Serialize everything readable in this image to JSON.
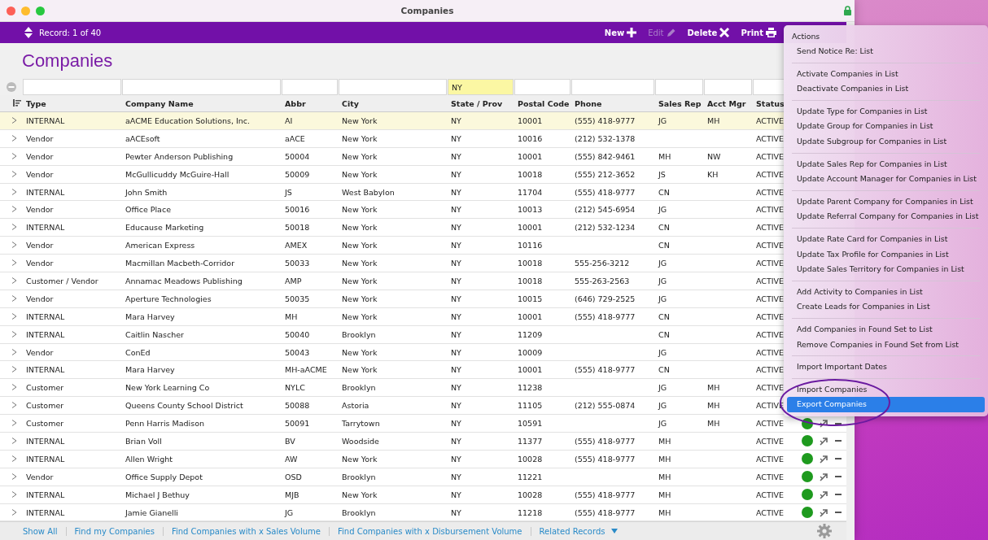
{
  "window": {
    "title": "Companies"
  },
  "toolbar": {
    "record": "Record: 1 of 40",
    "buttons": [
      {
        "label": "New",
        "kind": "new",
        "disabled": false
      },
      {
        "label": "Edit",
        "kind": "edit",
        "disabled": true
      },
      {
        "label": "Delete",
        "kind": "delete",
        "disabled": false
      },
      {
        "label": "Print",
        "kind": "print",
        "disabled": false
      }
    ]
  },
  "heading": "Companies",
  "filters": {
    "state": "NY"
  },
  "table": {
    "columns": [
      {
        "label": "Type"
      },
      {
        "label": "Company Name"
      },
      {
        "label": "Abbr"
      },
      {
        "label": "City"
      },
      {
        "label": "State / Prov"
      },
      {
        "label": "Postal Code"
      },
      {
        "label": "Phone"
      },
      {
        "label": "Sales Rep"
      },
      {
        "label": "Acct Mgr"
      },
      {
        "label": "Status"
      }
    ],
    "rows": [
      {
        "selected": true,
        "markers": false,
        "type": "INTERNAL",
        "company": "aACME Education Solutions, Inc.",
        "abbr": "AI",
        "city": "New York",
        "state": "NY",
        "postal": "10001",
        "phone": "(555) 418-9777",
        "sales_rep": "JG",
        "acct_mgr": "MH",
        "status": "ACTIVE"
      },
      {
        "selected": false,
        "markers": false,
        "type": "Vendor",
        "company": "aACEsoft",
        "abbr": "aACE",
        "city": "New York",
        "state": "NY",
        "postal": "10016",
        "phone": "(212) 532-1378",
        "status": "ACTIVE"
      },
      {
        "selected": false,
        "markers": false,
        "type": "Vendor",
        "company": "Pewter Anderson Publishing",
        "abbr": "50004",
        "city": "New York",
        "state": "NY",
        "postal": "10001",
        "phone": "(555) 842-9461",
        "sales_rep": "MH",
        "acct_mgr": "NW",
        "status": "ACTIVE"
      },
      {
        "selected": false,
        "markers": false,
        "type": "Vendor",
        "company": "McGullicuddy McGuire-Hall",
        "abbr": "50009",
        "city": "New York",
        "state": "NY",
        "postal": "10018",
        "phone": "(555) 212-3652",
        "sales_rep": "JS",
        "acct_mgr": "KH",
        "status": "ACTIVE"
      },
      {
        "selected": false,
        "markers": false,
        "type": "INTERNAL",
        "company": "John Smith",
        "abbr": "JS",
        "city": "West Babylon",
        "state": "NY",
        "postal": "11704",
        "phone": "(555) 418-9777",
        "sales_rep": "CN",
        "status": "ACTIVE"
      },
      {
        "selected": false,
        "markers": false,
        "type": "Vendor",
        "company": "Office Place",
        "abbr": "50016",
        "city": "New York",
        "state": "NY",
        "postal": "10013",
        "phone": "(212) 545-6954",
        "sales_rep": "JG",
        "status": "ACTIVE"
      },
      {
        "selected": false,
        "markers": false,
        "type": "INTERNAL",
        "company": "Educause Marketing",
        "abbr": "50018",
        "city": "New York",
        "state": "NY",
        "postal": "10001",
        "phone": "(212) 532-1234",
        "sales_rep": "CN",
        "status": "ACTIVE"
      },
      {
        "selected": false,
        "markers": false,
        "type": "Vendor",
        "company": "American Express",
        "abbr": "AMEX",
        "city": "New York",
        "state": "NY",
        "postal": "10116",
        "sales_rep": "CN",
        "status": "ACTIVE"
      },
      {
        "selected": false,
        "markers": false,
        "type": "Vendor",
        "company": "Macmillan Macbeth-Corridor",
        "abbr": "50033",
        "city": "New York",
        "state": "NY",
        "postal": "10018",
        "phone": "555-256-3212",
        "sales_rep": "JG",
        "status": "ACTIVE"
      },
      {
        "selected": false,
        "markers": false,
        "type": "Customer / Vendor",
        "company": "Annamac Meadows Publishing",
        "abbr": "AMP",
        "city": "New York",
        "state": "NY",
        "postal": "10018",
        "phone": "555-263-2563",
        "sales_rep": "JG",
        "status": "ACTIVE"
      },
      {
        "selected": false,
        "markers": false,
        "type": "Vendor",
        "company": "Aperture Technologies",
        "abbr": "50035",
        "city": "New York",
        "state": "NY",
        "postal": "10015",
        "phone": "(646) 729-2525",
        "sales_rep": "JG",
        "status": "ACTIVE"
      },
      {
        "selected": false,
        "markers": false,
        "type": "INTERNAL",
        "company": "Mara Harvey",
        "abbr": "MH",
        "city": "New York",
        "state": "NY",
        "postal": "10001",
        "phone": "(555) 418-9777",
        "sales_rep": "CN",
        "status": "ACTIVE"
      },
      {
        "selected": false,
        "markers": false,
        "type": "INTERNAL",
        "company": "Caitlin Nascher",
        "abbr": "50040",
        "city": "Brooklyn",
        "state": "NY",
        "postal": "11209",
        "sales_rep": "CN",
        "status": "ACTIVE"
      },
      {
        "selected": false,
        "markers": false,
        "type": "Vendor",
        "company": "ConEd",
        "abbr": "50043",
        "city": "New York",
        "state": "NY",
        "postal": "10009",
        "sales_rep": "JG",
        "status": "ACTIVE"
      },
      {
        "selected": false,
        "markers": false,
        "type": "INTERNAL",
        "company": "Mara Harvey",
        "abbr": "MH-aACME",
        "city": "New York",
        "state": "NY",
        "postal": "10001",
        "phone": "(555) 418-9777",
        "sales_rep": "CN",
        "status": "ACTIVE"
      },
      {
        "selected": false,
        "markers": false,
        "type": "Customer",
        "company": "New York Learning Co",
        "abbr": "NYLC",
        "city": "Brooklyn",
        "state": "NY",
        "postal": "11238",
        "sales_rep": "JG",
        "acct_mgr": "MH",
        "status": "ACTIVE"
      },
      {
        "selected": false,
        "markers": false,
        "type": "Customer",
        "company": "Queens County School District",
        "abbr": "50088",
        "city": "Astoria",
        "state": "NY",
        "postal": "11105",
        "phone": "(212) 555-0874",
        "sales_rep": "JG",
        "acct_mgr": "MH",
        "status": "ACTIVE"
      },
      {
        "selected": false,
        "markers": true,
        "type": "Customer",
        "company": "Penn Harris Madison",
        "abbr": "50091",
        "city": "Tarrytown",
        "state": "NY",
        "postal": "10591",
        "sales_rep": "JG",
        "acct_mgr": "MH",
        "status": "ACTIVE"
      },
      {
        "selected": false,
        "markers": true,
        "type": "INTERNAL",
        "company": "Brian Voll",
        "abbr": "BV",
        "city": "Woodside",
        "state": "NY",
        "postal": "11377",
        "phone": "(555) 418-9777",
        "sales_rep": "MH",
        "status": "ACTIVE"
      },
      {
        "selected": false,
        "markers": true,
        "type": "INTERNAL",
        "company": "Allen Wright",
        "abbr": "AW",
        "city": "New York",
        "state": "NY",
        "postal": "10028",
        "phone": "(555) 418-9777",
        "sales_rep": "MH",
        "status": "ACTIVE"
      },
      {
        "selected": false,
        "markers": true,
        "type": "Vendor",
        "company": "Office Supply Depot",
        "abbr": "OSD",
        "city": "Brooklyn",
        "state": "NY",
        "postal": "11221",
        "sales_rep": "MH",
        "status": "ACTIVE"
      },
      {
        "selected": false,
        "markers": true,
        "type": "INTERNAL",
        "company": "Michael J Bethuy",
        "abbr": "MJB",
        "city": "New York",
        "state": "NY",
        "postal": "10028",
        "phone": "(555) 418-9777",
        "sales_rep": "MH",
        "status": "ACTIVE"
      },
      {
        "selected": false,
        "markers": true,
        "type": "INTERNAL",
        "company": "Jamie Gianelli",
        "abbr": "JG",
        "city": "Brooklyn",
        "state": "NY",
        "postal": "11218",
        "phone": "(555) 418-9777",
        "sales_rep": "MH",
        "status": "ACTIVE"
      }
    ]
  },
  "footer": {
    "links": [
      "Show All",
      "Find my Companies",
      "Find Companies with x Sales Volume",
      "Find Companies with x Disbursement Volume"
    ],
    "related": "Related Records"
  },
  "actions_menu": {
    "title": "Actions",
    "groups": [
      [
        {
          "label": "Send Notice Re: List",
          "selected": false
        }
      ],
      [
        {
          "label": "Activate Companies in List",
          "selected": false
        },
        {
          "label": "Deactivate Companies in List",
          "selected": false
        }
      ],
      [
        {
          "label": "Update Type for Companies in List",
          "selected": false
        },
        {
          "label": "Update Group for Companies in List",
          "selected": false
        },
        {
          "label": "Update Subgroup for Companies in List",
          "selected": false
        }
      ],
      [
        {
          "label": "Update Sales Rep for Companies in List",
          "selected": false
        },
        {
          "label": "Update Account Manager for Companies in List",
          "selected": false
        }
      ],
      [
        {
          "label": "Update Parent Company for Companies in List",
          "selected": false
        },
        {
          "label": "Update Referral Company for Companies in List",
          "selected": false
        }
      ],
      [
        {
          "label": "Update Rate Card for Companies in List",
          "selected": false
        },
        {
          "label": "Update Tax Profile for Companies in List",
          "selected": false
        },
        {
          "label": "Update Sales Territory for Companies in List",
          "selected": false
        }
      ],
      [
        {
          "label": "Add Activity to Companies in List",
          "selected": false
        },
        {
          "label": "Create Leads for Companies in List",
          "selected": false
        }
      ],
      [
        {
          "label": "Add Companies in Found Set to List",
          "selected": false
        },
        {
          "label": "Remove Companies in Found Set from List",
          "selected": false
        }
      ],
      [
        {
          "label": "Import Important Dates",
          "selected": false
        }
      ],
      [
        {
          "label": "Import Companies",
          "selected": false
        },
        {
          "label": "Export Companies",
          "selected": true
        }
      ]
    ]
  }
}
